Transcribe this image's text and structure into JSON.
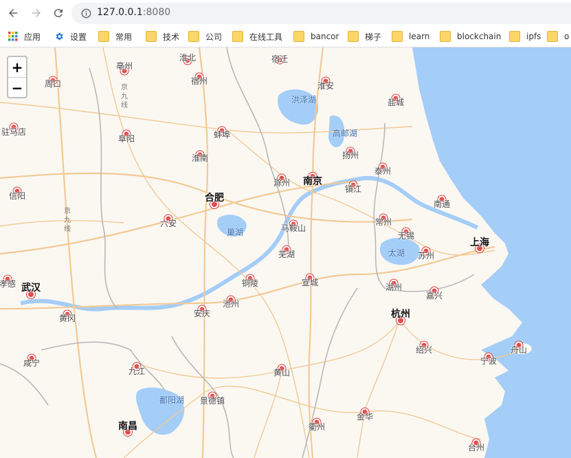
{
  "browser": {
    "url_host": "127.0.0.1",
    "url_port": ":8080"
  },
  "bookmarks": [
    {
      "label": "应用",
      "icon": "apps-grid-icon"
    },
    {
      "label": "设置",
      "icon": "gear-icon"
    },
    {
      "label": "常用",
      "icon": "folder-icon"
    },
    {
      "label": "技术",
      "icon": "folder-icon"
    },
    {
      "label": "公司",
      "icon": "folder-icon"
    },
    {
      "label": "在线工具",
      "icon": "folder-icon"
    },
    {
      "label": "bancor",
      "icon": "folder-icon"
    },
    {
      "label": "梯子",
      "icon": "folder-icon"
    },
    {
      "label": "learn",
      "icon": "folder-icon"
    },
    {
      "label": "blockchain",
      "icon": "folder-icon"
    },
    {
      "label": "ipfs",
      "icon": "folder-icon"
    },
    {
      "label": "o",
      "icon": "folder-icon"
    }
  ],
  "zoom": {
    "in_label": "+",
    "out_label": "−"
  },
  "map": {
    "colors": {
      "sea": "#a4cdf7",
      "land": "#fbf8f2",
      "road": "#f2c995",
      "boundary": "#b7b7b7"
    },
    "cities": [
      {
        "name": "亳州",
        "major": false
      },
      {
        "name": "淮北",
        "major": false
      },
      {
        "name": "宿迁",
        "major": false
      },
      {
        "name": "周口",
        "major": false
      },
      {
        "name": "宿州",
        "major": false
      },
      {
        "name": "淮安",
        "major": false
      },
      {
        "name": "盐城",
        "major": false
      },
      {
        "name": "驻马店",
        "major": false
      },
      {
        "name": "阜阳",
        "major": false
      },
      {
        "name": "蚌埠",
        "major": false
      },
      {
        "name": "淮南",
        "major": false
      },
      {
        "name": "扬州",
        "major": false
      },
      {
        "name": "泰州",
        "major": false
      },
      {
        "name": "信阳",
        "major": false
      },
      {
        "name": "滁州",
        "major": false
      },
      {
        "name": "南京",
        "major": true
      },
      {
        "name": "镇江",
        "major": false
      },
      {
        "name": "南通",
        "major": false
      },
      {
        "name": "合肥",
        "major": true
      },
      {
        "name": "六安",
        "major": false
      },
      {
        "name": "马鞍山",
        "major": false
      },
      {
        "name": "常州",
        "major": false
      },
      {
        "name": "无锡",
        "major": false
      },
      {
        "name": "上海",
        "major": true
      },
      {
        "name": "芜湖",
        "major": false
      },
      {
        "name": "苏州",
        "major": false
      },
      {
        "name": "孝感",
        "major": false
      },
      {
        "name": "武汉",
        "major": true
      },
      {
        "name": "铜陵",
        "major": false
      },
      {
        "name": "宣城",
        "major": false
      },
      {
        "name": "湖州",
        "major": false
      },
      {
        "name": "嘉兴",
        "major": false
      },
      {
        "name": "池州",
        "major": false
      },
      {
        "name": "安庆",
        "major": false
      },
      {
        "name": "黄冈",
        "major": false
      },
      {
        "name": "杭州",
        "major": true
      },
      {
        "name": "绍兴",
        "major": false
      },
      {
        "name": "舟山",
        "major": false
      },
      {
        "name": "宁波",
        "major": false
      },
      {
        "name": "咸宁",
        "major": false
      },
      {
        "name": "九江",
        "major": false
      },
      {
        "name": "黄山",
        "major": false
      },
      {
        "name": "景德镇",
        "major": false
      },
      {
        "name": "金华",
        "major": false
      },
      {
        "name": "南昌",
        "major": true
      },
      {
        "name": "衢州",
        "major": false
      },
      {
        "name": "台州",
        "major": false
      }
    ],
    "water_labels": [
      "洪泽湖",
      "高邮湖",
      "巢湖",
      "太湖",
      "鄱阳湖"
    ],
    "road_labels": [
      "京九线",
      "京九线"
    ]
  }
}
